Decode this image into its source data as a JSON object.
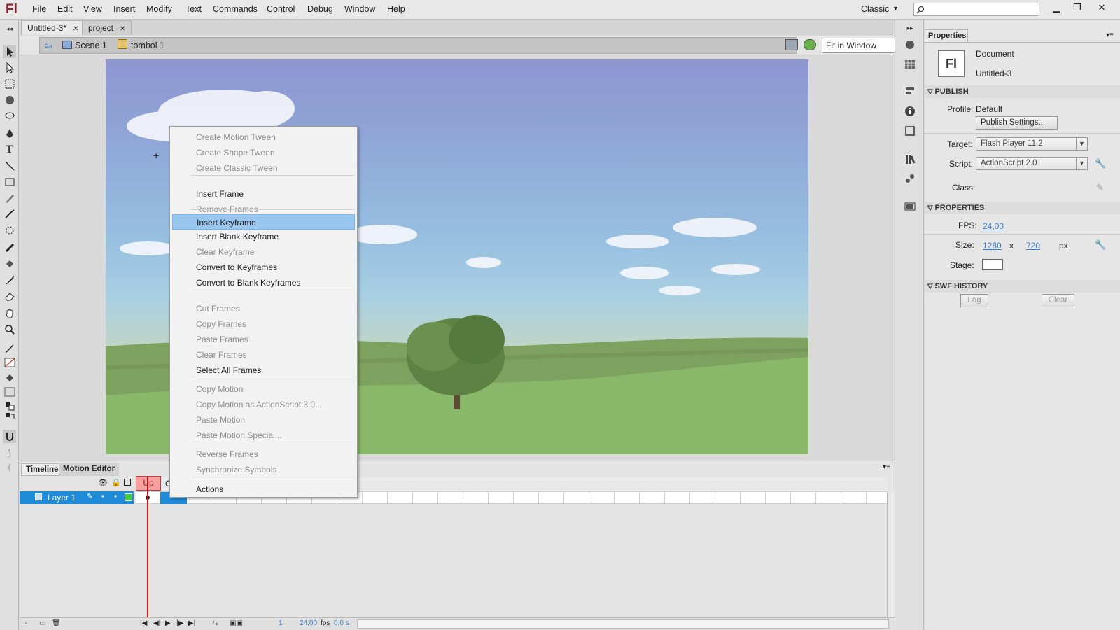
{
  "app": {
    "logo": "Fl"
  },
  "menubar": {
    "items": [
      "File",
      "Edit",
      "View",
      "Insert",
      "Modify",
      "Text",
      "Commands",
      "Control",
      "Debug",
      "Window",
      "Help"
    ],
    "workspace": "Classic"
  },
  "doc_tabs": [
    {
      "label": "Untitled-3*"
    },
    {
      "label": "project"
    }
  ],
  "editbar": {
    "scene": "Scene 1",
    "symbol": "tombol 1",
    "zoom": "Fit in Window"
  },
  "context_menu": {
    "items": [
      {
        "label": "Create Motion Tween",
        "enabled": false
      },
      {
        "label": "Create Shape Tween",
        "enabled": false
      },
      {
        "label": "Create Classic Tween",
        "enabled": false
      },
      {
        "label": "Insert Frame",
        "enabled": true
      },
      {
        "label": "Remove Frames",
        "enabled": false
      },
      {
        "label": "Insert Keyframe",
        "enabled": true,
        "highlighted": true
      },
      {
        "label": "Insert Blank Keyframe",
        "enabled": true
      },
      {
        "label": "Clear Keyframe",
        "enabled": false
      },
      {
        "label": "Convert to Keyframes",
        "enabled": true
      },
      {
        "label": "Convert to Blank Keyframes",
        "enabled": true
      },
      {
        "label": "Cut Frames",
        "enabled": false
      },
      {
        "label": "Copy Frames",
        "enabled": false
      },
      {
        "label": "Paste Frames",
        "enabled": false
      },
      {
        "label": "Clear Frames",
        "enabled": false
      },
      {
        "label": "Select All Frames",
        "enabled": true
      },
      {
        "label": "Copy Motion",
        "enabled": false
      },
      {
        "label": "Copy Motion as ActionScript 3.0...",
        "enabled": false
      },
      {
        "label": "Paste Motion",
        "enabled": false
      },
      {
        "label": "Paste Motion Special...",
        "enabled": false
      },
      {
        "label": "Reverse Frames",
        "enabled": false
      },
      {
        "label": "Synchronize Symbols",
        "enabled": false
      },
      {
        "label": "Actions",
        "enabled": true
      }
    ]
  },
  "timeline": {
    "tabs": [
      "Timeline",
      "Motion Editor"
    ],
    "layer": "Layer 1",
    "frame_label": "Up",
    "frame_label_next": "O",
    "current_frame": "1",
    "fps": "24,00",
    "fps_unit": "fps",
    "time": "0,0 s"
  },
  "properties": {
    "tab": "Properties",
    "doc_type": "Document",
    "doc_name": "Untitled-3",
    "publish": {
      "header": "PUBLISH",
      "profile_label": "Profile:",
      "profile": "Default",
      "settings_btn": "Publish Settings...",
      "target_label": "Target:",
      "target": "Flash Player 11.2",
      "script_label": "Script:",
      "script": "ActionScript 2.0",
      "class_label": "Class:"
    },
    "props": {
      "header": "PROPERTIES",
      "fps_label": "FPS:",
      "fps": "24,00",
      "size_label": "Size:",
      "width": "1280",
      "x": "x",
      "height": "720",
      "unit": "px",
      "stage_label": "Stage:",
      "stage_color": "#ffffff"
    },
    "history": {
      "header": "SWF HISTORY",
      "log": "Log",
      "clear": "Clear"
    }
  },
  "colors": {
    "accent": "#1f8bd9",
    "menu_highlight": "#99c7ef",
    "playhead": "#c81414"
  }
}
